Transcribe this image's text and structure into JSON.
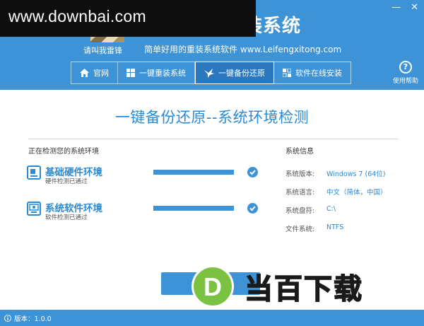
{
  "header": {
    "watermark": "www.downbai.com",
    "app_title": "装系统",
    "logo_caption": "请叫我雷锋",
    "slogan": "简单好用的重装系统软件 www.Leifengxitong.com",
    "window_buttons": [
      "—",
      "✕"
    ]
  },
  "nav": {
    "items": [
      {
        "label": "官网",
        "icon": "home-icon"
      },
      {
        "label": "一键重装系统",
        "icon": "windows-icon"
      },
      {
        "label": "一键备份还原",
        "icon": "bird-icon",
        "active": true
      },
      {
        "label": "软件在线安装",
        "icon": "tiles-icon"
      }
    ]
  },
  "help": {
    "label": "使用帮助",
    "glyph": "?"
  },
  "main": {
    "title": "一键备份还原--系统环境检测",
    "detect_heading": "正在检测您的系统环境",
    "checks": [
      {
        "title": "基础硬件环境",
        "subtitle": "硬件检测已通过",
        "icon": "hardware-icon",
        "progress": 1.0,
        "status": "passed"
      },
      {
        "title": "系统软件环境",
        "subtitle": "软件检测已通过",
        "icon": "software-icon",
        "progress": 1.0,
        "status": "passed"
      }
    ]
  },
  "system_info": {
    "heading": "系统信息",
    "rows": [
      {
        "key": "系统版本:",
        "value": "Windows 7 (64位)"
      },
      {
        "key": "系统语言:",
        "value": "中文（简体，中国）"
      },
      {
        "key": "系统盘符:",
        "value": "C:\\"
      },
      {
        "key": "文件系统:",
        "value": "NTFS"
      }
    ]
  },
  "brand_overlay": {
    "letter": "D",
    "text": "当百下载"
  },
  "footer": {
    "version_label": "版本：1.0.0"
  },
  "colors": {
    "primary": "#3d93d6",
    "accent_text": "#2a8ad3",
    "brand_green": "#7cc242"
  }
}
